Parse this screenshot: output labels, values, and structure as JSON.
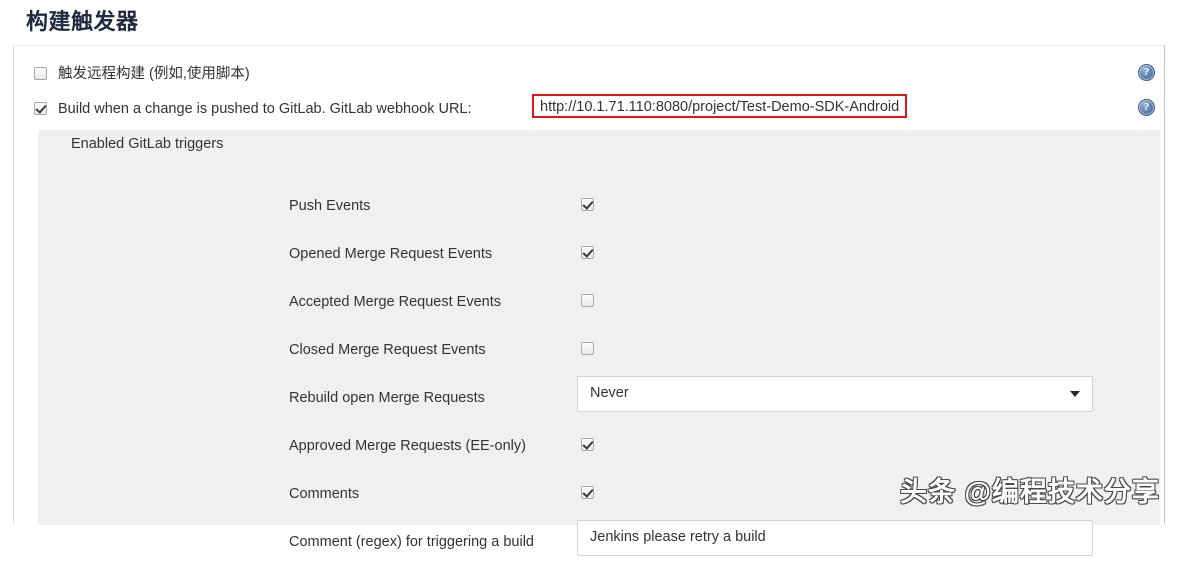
{
  "page": {
    "title": "构建触发器"
  },
  "top_options": [
    {
      "label": "触发远程构建 (例如,使用脚本)",
      "checked": false,
      "help": "?"
    },
    {
      "label": "Build when a change is pushed to GitLab. GitLab webhook URL:",
      "checked": true,
      "help": "?",
      "url": "http://10.1.71.110:8080/project/Test-Demo-SDK-Android"
    }
  ],
  "section": {
    "label": "Enabled GitLab triggers"
  },
  "triggers": [
    {
      "label": "Push Events",
      "type": "checkbox",
      "checked": true
    },
    {
      "label": "Opened Merge Request Events",
      "type": "checkbox",
      "checked": true
    },
    {
      "label": "Accepted Merge Request Events",
      "type": "checkbox",
      "checked": false
    },
    {
      "label": "Closed Merge Request Events",
      "type": "checkbox",
      "checked": false
    },
    {
      "label": "Rebuild open Merge Requests",
      "type": "select",
      "value": "Never"
    },
    {
      "label": "Approved Merge Requests (EE-only)",
      "type": "checkbox",
      "checked": true
    },
    {
      "label": "Comments",
      "type": "checkbox",
      "checked": true
    },
    {
      "label": "Comment (regex) for triggering a build",
      "type": "text",
      "value": "Jenkins please retry a build"
    }
  ],
  "colors": {
    "highlight_border": "#e81313",
    "panel_background": "#f0f0f0",
    "title": "#1f2a40",
    "help_icon": "#5b7fae"
  },
  "watermark": {
    "text": "头条 @编程技术分享"
  }
}
